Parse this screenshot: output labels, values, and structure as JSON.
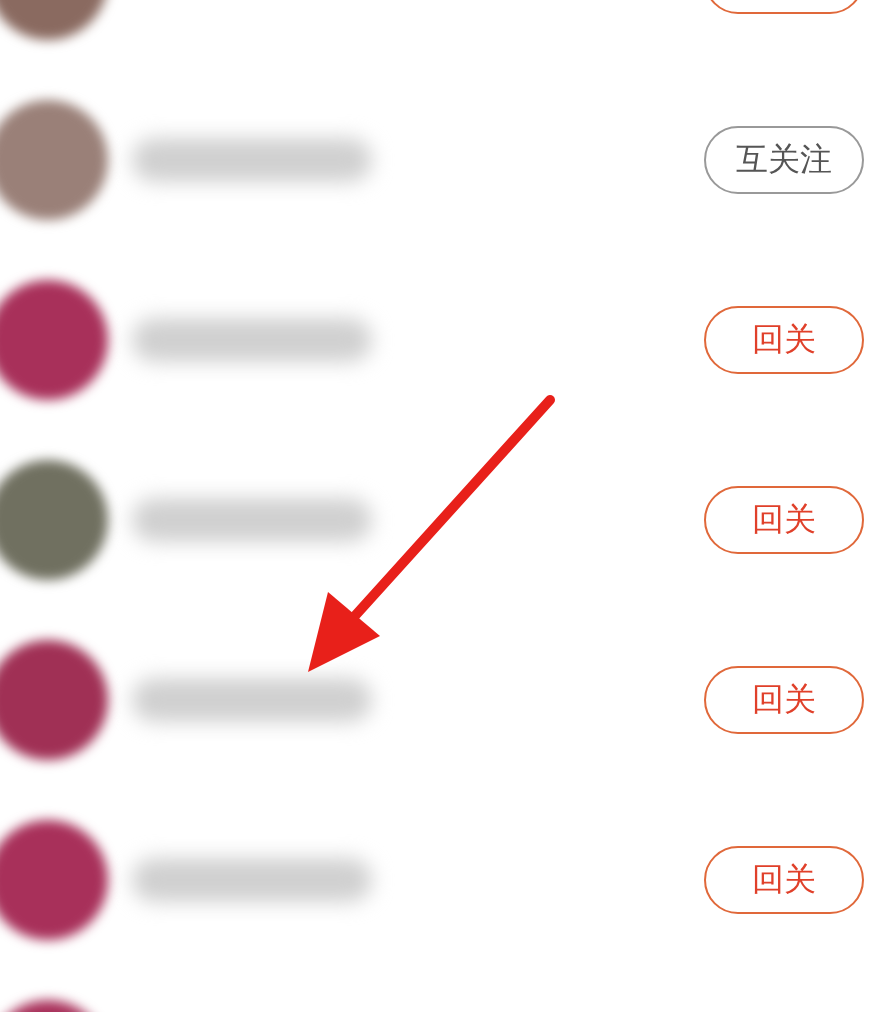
{
  "rows": [
    {
      "color": "#8a6a60",
      "button": {
        "kind": "follow_back"
      }
    },
    {
      "color": "#9a8078",
      "button": {
        "kind": "mutual",
        "label": "互关注"
      }
    },
    {
      "color": "#a8305a",
      "button": {
        "kind": "follow_back",
        "label": "回关"
      }
    },
    {
      "color": "#707060",
      "button": {
        "kind": "follow_back",
        "label": "回关"
      }
    },
    {
      "color": "#a03055",
      "button": {
        "kind": "follow_back",
        "label": "回关"
      }
    },
    {
      "color": "#a8305a",
      "button": {
        "kind": "follow_back",
        "label": "回关"
      }
    },
    {
      "color": "#a8305a"
    }
  ]
}
